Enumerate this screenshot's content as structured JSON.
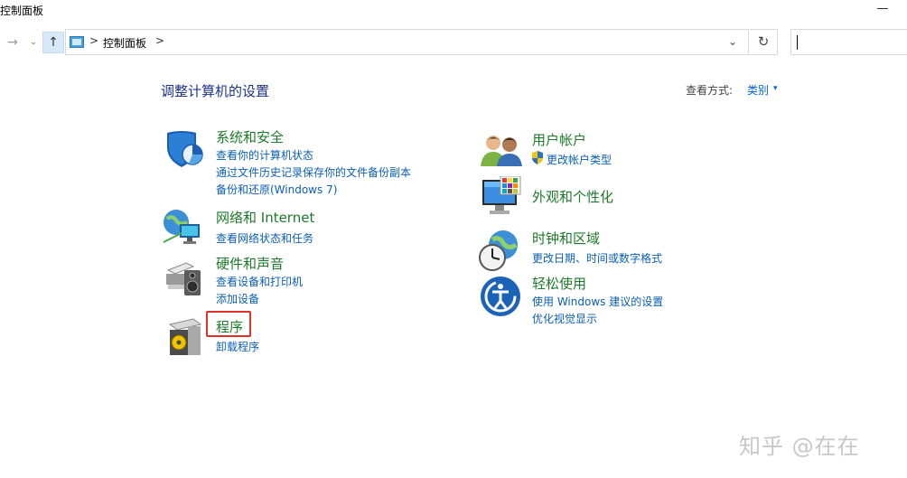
{
  "window": {
    "title": "控制面板",
    "minimize_glyph": "—"
  },
  "address": {
    "back_glyph": "→",
    "dropdown_glyph": "⌄",
    "up_glyph": "↑",
    "breadcrumb": "控制面板",
    "separator": ">",
    "path_dropdown_glyph": "⌄",
    "refresh_glyph": "↻",
    "search_value": ""
  },
  "main": {
    "heading": "调整计算机的设置",
    "view_by_label": "查看方式:",
    "view_by_value": "类别",
    "view_by_arrow": "▾"
  },
  "categories": {
    "system_security": {
      "title": "系统和安全",
      "links": [
        "查看你的计算机状态",
        "通过文件历史记录保存你的文件备份副本",
        "备份和还原(Windows 7)"
      ]
    },
    "network": {
      "title": "网络和 Internet",
      "links": [
        "查看网络状态和任务"
      ]
    },
    "hardware": {
      "title": "硬件和声音",
      "links": [
        "查看设备和打印机",
        "添加设备"
      ]
    },
    "programs": {
      "title": "程序",
      "links": [
        "卸载程序"
      ]
    },
    "user_accounts": {
      "title": "用户帐户",
      "links": [
        "更改帐户类型"
      ]
    },
    "appearance": {
      "title": "外观和个性化",
      "links": []
    },
    "clock_region": {
      "title": "时钟和区域",
      "links": [
        "更改日期、时间或数字格式"
      ]
    },
    "ease_access": {
      "title": "轻松使用",
      "links": [
        "使用 Windows 建议的设置",
        "优化视觉显示"
      ]
    }
  },
  "watermark": "知乎 @在在",
  "colors": {
    "heading": "#1e3287",
    "category_title": "#1d7a2a",
    "link": "#0b5fb3",
    "highlight": "#e0302a"
  },
  "icons": [
    "shield-icon",
    "network-globe-icon",
    "printer-speaker-icon",
    "programs-box-icon",
    "users-icon",
    "uac-shield-icon",
    "monitor-palette-icon",
    "clock-globe-icon",
    "ease-of-access-icon",
    "refresh-icon",
    "up-arrow-icon"
  ]
}
